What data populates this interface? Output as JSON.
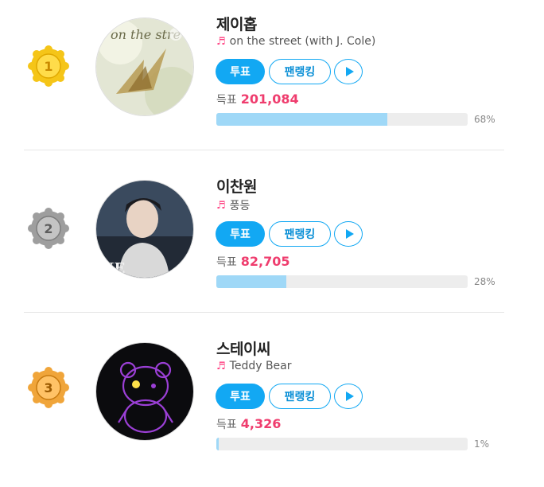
{
  "ranking": [
    {
      "rank": "1",
      "medal_color": "#f5c518",
      "artist": "제이홉",
      "song": "on the street (with J. Cole)",
      "vote_label": "투표",
      "ranking_label": "팬랭킹",
      "votes_label": "득표",
      "votes": "201,084",
      "percent_text": "68%",
      "percent_value": 68
    },
    {
      "rank": "2",
      "medal_color": "#9e9e9e",
      "artist": "이찬원",
      "song": "풍등",
      "vote_label": "투표",
      "ranking_label": "팬랭킹",
      "votes_label": "득표",
      "votes": "82,705",
      "percent_text": "28%",
      "percent_value": 28
    },
    {
      "rank": "3",
      "medal_color": "#f0a53a",
      "artist": "스테이씨",
      "song": "Teddy Bear",
      "vote_label": "투표",
      "ranking_label": "팬랭킹",
      "votes_label": "득표",
      "votes": "4,326",
      "percent_text": "1%",
      "percent_value": 1
    }
  ],
  "icons": {
    "note": "♬",
    "play": "play-icon"
  },
  "colors": {
    "accent": "#12a8f3",
    "votes_number": "#ef3d6e",
    "bar_fill": "#9fd8f7",
    "bar_track": "#ededed"
  }
}
